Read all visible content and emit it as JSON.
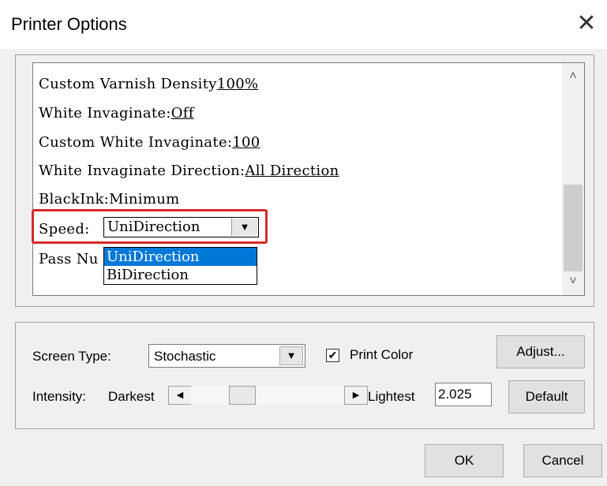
{
  "window": {
    "title": "Printer Options",
    "close_glyph": "✕"
  },
  "options_list": {
    "rows": [
      {
        "label": "Custom Varnish Density",
        "value": "100%"
      },
      {
        "label": "White Invaginate:",
        "value": "Off"
      },
      {
        "label": "Custom White Invaginate:",
        "value": "100"
      },
      {
        "label": "White Invaginate Direction:",
        "value": "All Direction"
      },
      {
        "label": "BlackInk:",
        "value": "Minimum"
      }
    ],
    "speed": {
      "label": "Speed:",
      "selected": "UniDirection",
      "options": [
        "UniDirection",
        "BiDirection"
      ]
    },
    "pass_label_partial": "Pass Nu",
    "scroll_up": "˄",
    "scroll_down": "˅"
  },
  "settings": {
    "screen_type_label": "Screen Type:",
    "screen_type_value": "Stochastic",
    "print_color_label": "Print Color",
    "print_color_checked": true,
    "check_glyph": "✔",
    "adjust_label": "Adjust...",
    "intensity_label": "Intensity:",
    "darkest_label": "Darkest",
    "lightest_label": "Lightest",
    "intensity_value": "2.025",
    "default_label": "Default",
    "left_arrow": "◀",
    "right_arrow": "▶",
    "dropdown_arrow": "▼"
  },
  "footer": {
    "ok_label": "OK",
    "cancel_label": "Cancel"
  },
  "colors": {
    "highlight_border": "#d62a2a",
    "selection_bg": "#0078d7"
  }
}
